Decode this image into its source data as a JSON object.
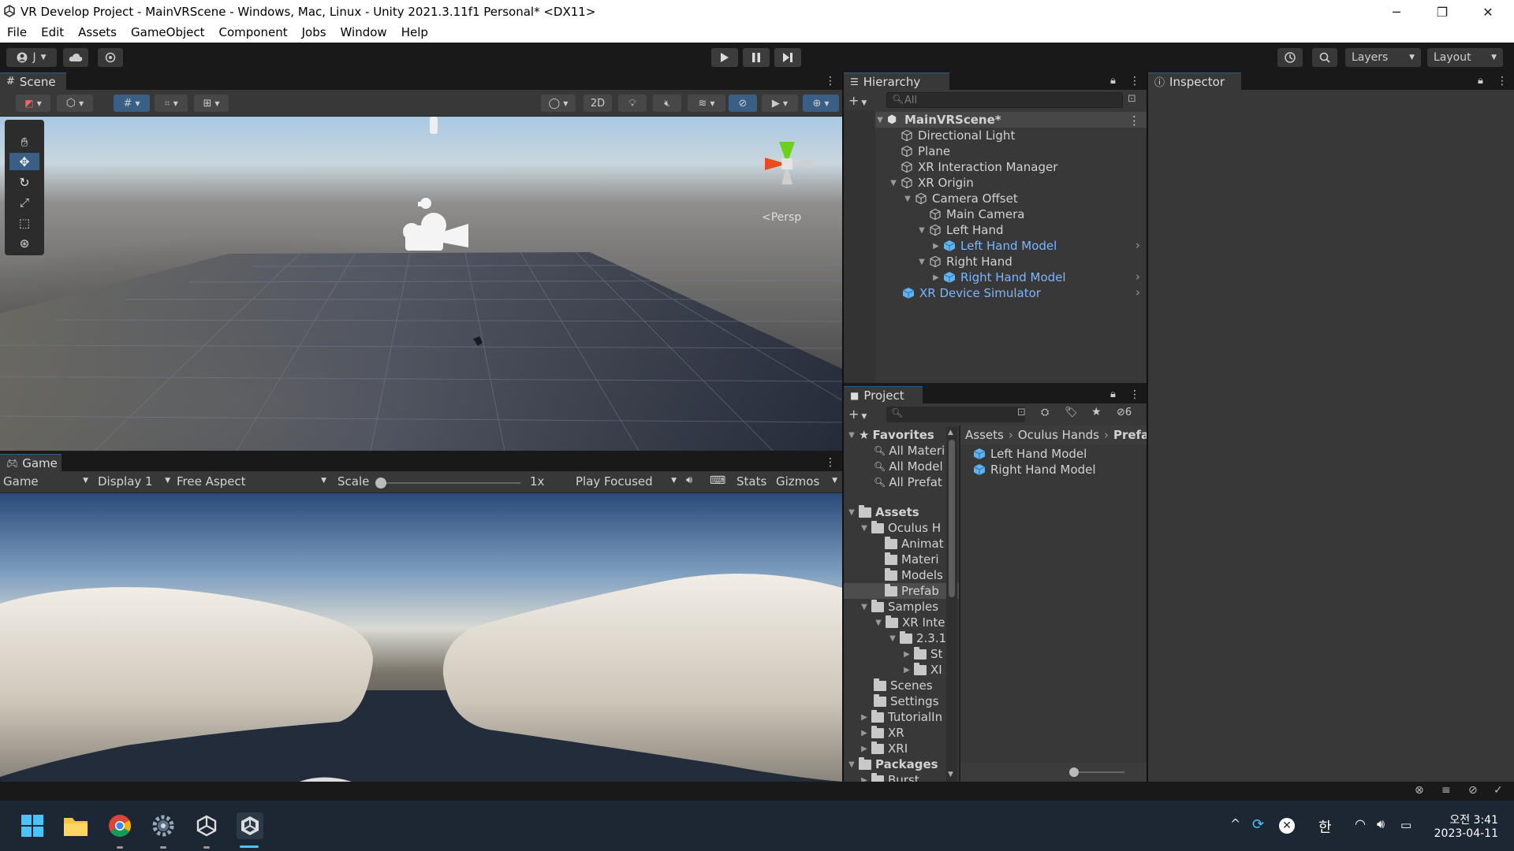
{
  "window": {
    "title": "VR Develop Project - MainVRScene - Windows, Mac, Linux - Unity 2021.3.11f1 Personal* <DX11>",
    "controls": [
      "─",
      "❐",
      "✕"
    ]
  },
  "menu": [
    "File",
    "Edit",
    "Assets",
    "GameObject",
    "Component",
    "Jobs",
    "Window",
    "Help"
  ],
  "toolbar": {
    "account_label": "J",
    "layers_label": "Layers",
    "layout_label": "Layout"
  },
  "scene": {
    "tab_label": "Scene",
    "btn_2d": "2D",
    "persp_label": "<Persp"
  },
  "game": {
    "tab_label": "Game",
    "mode": "Game",
    "display": "Display 1",
    "aspect": "Free Aspect",
    "scale_label": "Scale",
    "scale_value": "1x",
    "play_focused": "Play Focused",
    "stats": "Stats",
    "gizmos": "Gizmos"
  },
  "hierarchy": {
    "tab_label": "Hierarchy",
    "search_placeholder": "All",
    "scene_name": "MainVRScene*",
    "items": [
      {
        "label": "Directional Light"
      },
      {
        "label": "Plane"
      },
      {
        "label": "XR Interaction Manager"
      },
      {
        "label": "XR Origin"
      },
      {
        "label": "Camera Offset"
      },
      {
        "label": "Main Camera"
      },
      {
        "label": "Left Hand"
      },
      {
        "label": "Left Hand Model"
      },
      {
        "label": "Right Hand"
      },
      {
        "label": "Right Hand Model"
      },
      {
        "label": "XR Device Simulator"
      }
    ]
  },
  "inspector": {
    "tab_label": "Inspector"
  },
  "project": {
    "tab_label": "Project",
    "hidden_count": "6",
    "favorites_label": "Favorites",
    "favorites": [
      "All Materi",
      "All Model",
      "All Prefat"
    ],
    "assets_label": "Assets",
    "tree": [
      "Oculus H",
      "Animat",
      "Materi",
      "Models",
      "Prefab",
      "Samples",
      "XR Inte",
      "2.3.1",
      "St",
      "XI",
      "Scenes",
      "Settings",
      "TutorialIn",
      "XR",
      "XRI"
    ],
    "packages_label": "Packages",
    "packages": [
      "Burst"
    ],
    "breadcrumb": [
      "Assets",
      "Oculus Hands",
      "Prefa"
    ],
    "files": [
      "Left Hand Model",
      "Right Hand Model"
    ]
  },
  "taskbar": {
    "ime": "한",
    "time": "오전 3:41",
    "date": "2023-04-11"
  }
}
